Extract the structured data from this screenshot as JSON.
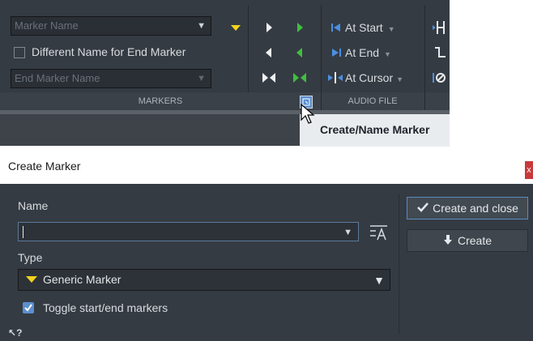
{
  "ribbon": {
    "marker_name_placeholder": "Marker Name",
    "different_name_label": "Different Name for End Marker",
    "end_marker_name_placeholder": "End Marker Name",
    "group_markers_label": "MARKERS",
    "group_audio_file_label": "AUDIO FILE",
    "at_start_label": "At Start",
    "at_end_label": "At End",
    "at_cursor_label": "At Cursor"
  },
  "tooltip": {
    "text": "Create/Name Marker"
  },
  "dialog": {
    "title": "Create Marker",
    "close_label": "x",
    "name_label": "Name",
    "name_value": "",
    "type_label": "Type",
    "type_value": "Generic Marker",
    "toggle_label": "Toggle start/end markers",
    "toggle_checked": true,
    "create_close_label": "Create and close",
    "create_label": "Create",
    "help_glyph": "?"
  },
  "colors": {
    "panel_bg": "#353b42",
    "marker_yellow": "#f2d21f",
    "marker_green": "#3fbf3f",
    "accent_blue": "#5b8fcf"
  }
}
